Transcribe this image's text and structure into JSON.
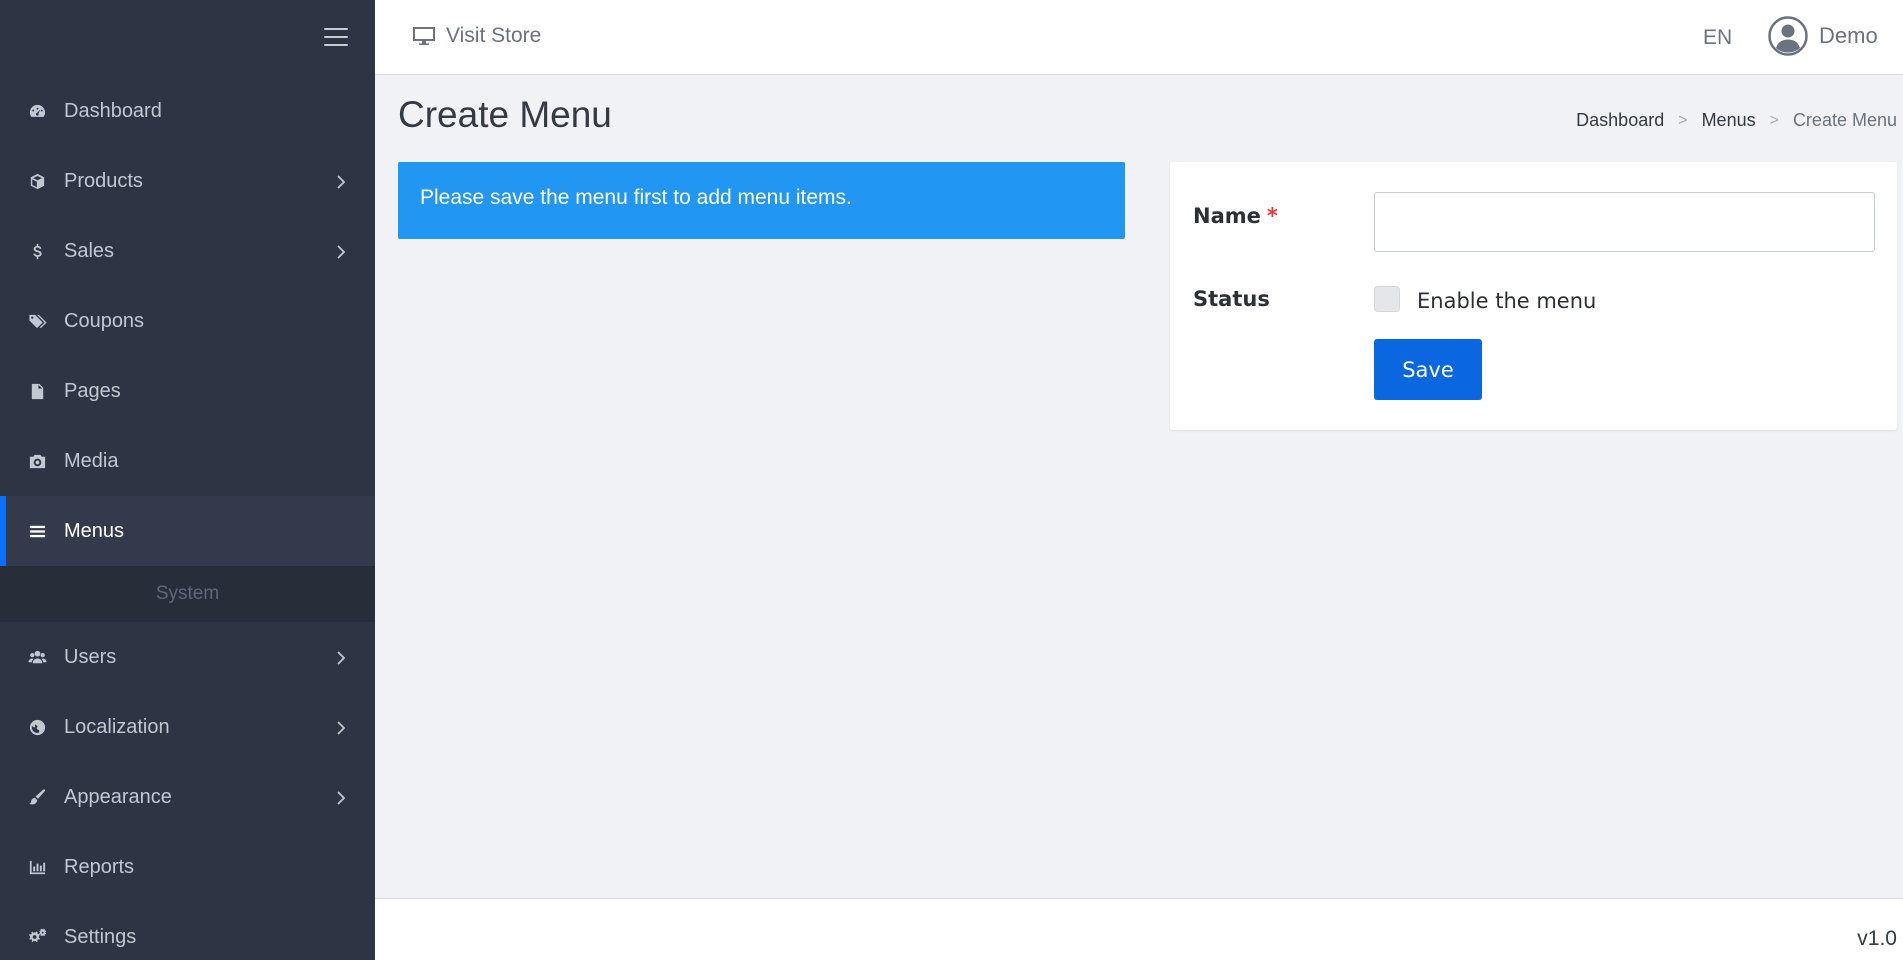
{
  "sidebar": {
    "items": [
      {
        "label": "Dashboard",
        "icon": "dashboard-icon",
        "has_children": false
      },
      {
        "label": "Products",
        "icon": "box-icon",
        "has_children": true
      },
      {
        "label": "Sales",
        "icon": "dollar-icon",
        "has_children": true
      },
      {
        "label": "Coupons",
        "icon": "tags-icon",
        "has_children": false
      },
      {
        "label": "Pages",
        "icon": "file-icon",
        "has_children": false
      },
      {
        "label": "Media",
        "icon": "camera-icon",
        "has_children": false
      },
      {
        "label": "Menus",
        "icon": "bars-icon",
        "has_children": false,
        "active": true
      }
    ],
    "section_header": "System",
    "system_items": [
      {
        "label": "Users",
        "icon": "users-icon",
        "has_children": true
      },
      {
        "label": "Localization",
        "icon": "globe-icon",
        "has_children": true
      },
      {
        "label": "Appearance",
        "icon": "paint-brush-icon",
        "has_children": true
      },
      {
        "label": "Reports",
        "icon": "bar-chart-icon",
        "has_children": false
      },
      {
        "label": "Settings",
        "icon": "cogs-icon",
        "has_children": false
      }
    ]
  },
  "header": {
    "visit_store": "Visit Store",
    "language": "EN",
    "user_name": "Demo"
  },
  "page": {
    "title": "Create Menu",
    "breadcrumb": [
      "Dashboard",
      "Menus",
      "Create Menu"
    ]
  },
  "alert": {
    "message": "Please save the menu first to add menu items."
  },
  "form": {
    "name_label": "Name",
    "required_mark": "*",
    "name_value": "",
    "status_label": "Status",
    "status_checkbox_label": "Enable the menu",
    "status_checked": false,
    "save_label": "Save"
  },
  "footer": {
    "version": "v1.0"
  },
  "colors": {
    "sidebar_bg": "#2e3444",
    "accent": "#0b67e0",
    "alert_bg": "#2196f3",
    "required": "#e53935"
  }
}
